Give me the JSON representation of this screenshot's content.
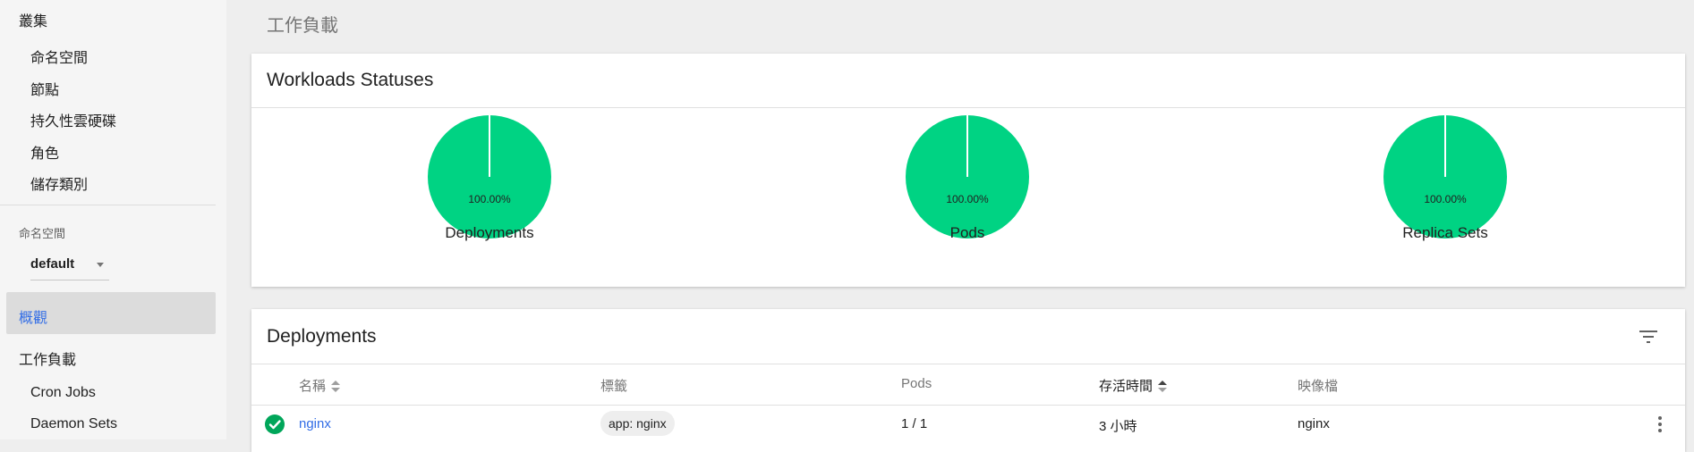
{
  "sidebar": {
    "cluster_heading": "叢集",
    "cluster_items": [
      "命名空間",
      "節點",
      "持久性雲硬碟",
      "角色",
      "儲存類別"
    ],
    "namespace_label": "命名空間",
    "namespace_value": "default",
    "overview": "概觀",
    "workloads_heading": "工作負載",
    "workload_items": [
      "Cron Jobs",
      "Daemon Sets"
    ]
  },
  "page": {
    "title": "工作負載"
  },
  "statuses_card": {
    "title": "Workloads Statuses",
    "charts": [
      {
        "label": "Deployments",
        "percent_text": "100.00%",
        "running_fraction": 1.0
      },
      {
        "label": "Pods",
        "percent_text": "100.00%",
        "running_fraction": 1.0
      },
      {
        "label": "Replica Sets",
        "percent_text": "100.00%",
        "running_fraction": 1.0
      }
    ],
    "color": "#00d383"
  },
  "deployments_card": {
    "title": "Deployments",
    "columns": {
      "name": "名稱",
      "labels": "標籤",
      "pods": "Pods",
      "age": "存活時間",
      "images": "映像檔"
    },
    "rows": [
      {
        "name": "nginx",
        "label": "app: nginx",
        "pods": "1 / 1",
        "age": "3 小時",
        "image": "nginx",
        "status": "running"
      }
    ]
  },
  "colors": {
    "accent": "#326de6",
    "success": "#00a65a"
  },
  "icons": {
    "filter": "filter-icon",
    "status": "check-circle-icon",
    "more": "more-vert-icon"
  }
}
